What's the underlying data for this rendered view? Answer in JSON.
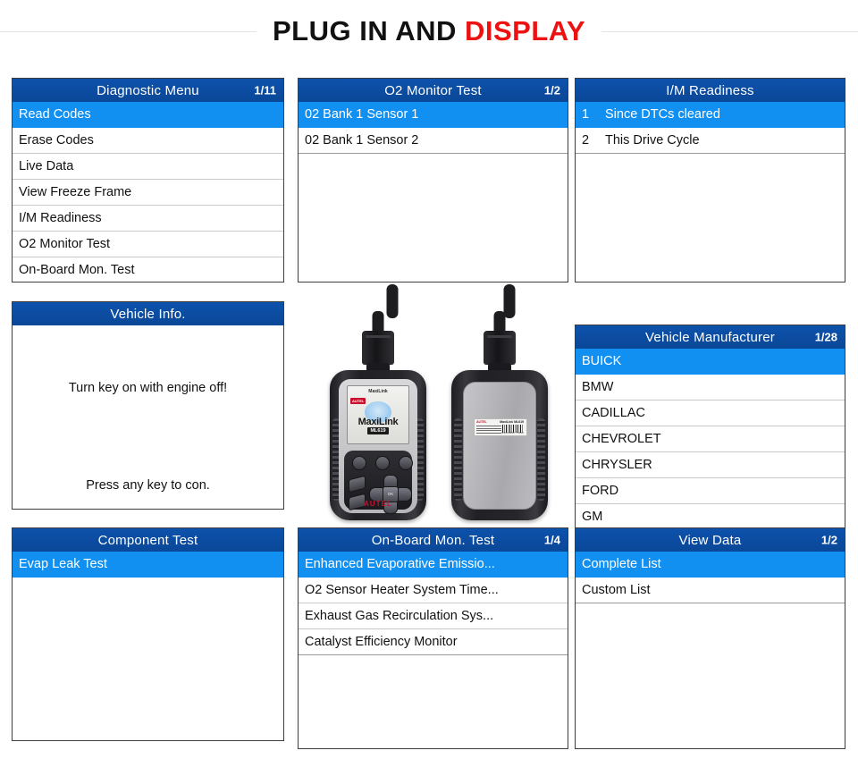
{
  "title": {
    "text_black": "PLUG IN AND",
    "text_red": "DISPLAY"
  },
  "panels": {
    "diagnostic_menu": {
      "title": "Diagnostic Menu",
      "counter": "1/11",
      "items": [
        "Read Codes",
        "Erase Codes",
        "Live Data",
        "View Freeze Frame",
        "I/M Readiness",
        "O2 Monitor Test",
        "On-Board Mon. Test"
      ]
    },
    "o2_monitor_test": {
      "title": "O2 Monitor Test",
      "counter": "1/2",
      "items": [
        "02 Bank 1 Sensor 1",
        "02 Bank 1 Sensor 2"
      ]
    },
    "im_readiness": {
      "title": "I/M Readiness",
      "counter": "",
      "items": [
        {
          "index": "1",
          "label": "Since DTCs cleared"
        },
        {
          "index": "2",
          "label": "This Drive Cycle"
        }
      ]
    },
    "vehicle_info": {
      "title": "Vehicle Info.",
      "message_top": "Turn key on with engine off!",
      "message_bottom": "Press any key to con."
    },
    "vehicle_manufacturer": {
      "title": "Vehicle Manufacturer",
      "counter": "1/28",
      "items": [
        "BUICK",
        "BMW",
        "CADILLAC",
        "CHEVROLET",
        "CHRYSLER",
        "FORD",
        "GM"
      ]
    },
    "component_test": {
      "title": "Component Test",
      "counter": "",
      "items": [
        "Evap Leak Test"
      ]
    },
    "onboard_mon_test": {
      "title": "On-Board Mon. Test",
      "counter": "1/4",
      "items": [
        "Enhanced Evaporative Emissio...",
        "O2 Sensor Heater System Time...",
        "Exhaust Gas Recirculation Sys...",
        "Catalyst Efficiency Monitor"
      ]
    },
    "view_data": {
      "title": "View Data",
      "counter": "1/2",
      "items": [
        "Complete List",
        "Custom List"
      ]
    }
  },
  "device": {
    "screen_header_brand": "MaxiLink",
    "screen_header_model": "ML619",
    "screen_corner_brand": "AUTEL",
    "screen_brand": "MaxiLink",
    "screen_model": "ML619",
    "keypad_ok_label": "OK",
    "front_brand": "AUTEL",
    "back_label_brand": "AUTEL",
    "back_label_model": "MaxiLink ML619",
    "back_label_barcode_number": "SN000000 / 0000"
  },
  "colors": {
    "header_blue": "#0a4797",
    "selected_blue": "#1290f2",
    "title_red": "#ee1111",
    "panel_border": "#3d3d3d"
  }
}
